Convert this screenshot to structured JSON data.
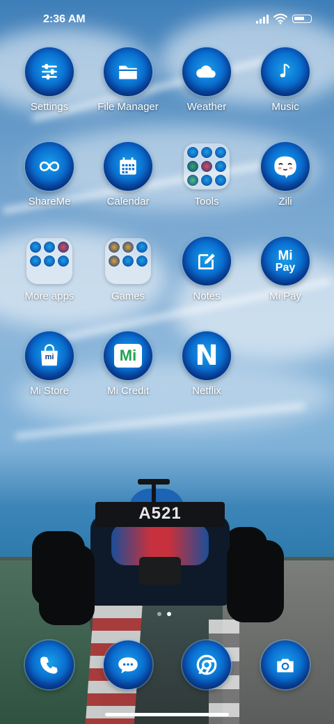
{
  "status_bar": {
    "time": "2:36 AM"
  },
  "wallpaper": {
    "car_number": "A521"
  },
  "apps": [
    {
      "label": "Settings",
      "icon": "settings-icon"
    },
    {
      "label": "File Manager",
      "icon": "folder-icon"
    },
    {
      "label": "Weather",
      "icon": "weather-icon"
    },
    {
      "label": "Music",
      "icon": "music-note-icon"
    },
    {
      "label": "ShareMe",
      "icon": "shareme-icon"
    },
    {
      "label": "Calendar",
      "icon": "calendar-icon"
    },
    {
      "label": "Tools",
      "icon": "folder-grid-icon"
    },
    {
      "label": "Zili",
      "icon": "zili-face-icon"
    },
    {
      "label": "More apps",
      "icon": "folder-grid-icon"
    },
    {
      "label": "Games",
      "icon": "folder-grid-icon"
    },
    {
      "label": "Notes",
      "icon": "notes-icon"
    },
    {
      "label": "Mi Pay",
      "icon": "mi-pay-icon",
      "glyph_line1": "Mi",
      "glyph_line2": "Pay"
    },
    {
      "label": "Mi Store",
      "icon": "shopping-bag-icon",
      "glyph": "mi"
    },
    {
      "label": "Mi Credit",
      "icon": "mi-credit-icon",
      "glyph": "Mi"
    },
    {
      "label": "Netflix",
      "icon": "netflix-icon",
      "glyph": "N"
    }
  ],
  "dock": [
    {
      "icon": "phone-icon"
    },
    {
      "icon": "messages-icon"
    },
    {
      "icon": "chrome-icon"
    },
    {
      "icon": "camera-icon"
    }
  ],
  "page_indicator": {
    "pages": 2,
    "active": 2
  },
  "colors": {
    "icon_blue": "#0a6fd0",
    "label": "#ffffff"
  }
}
